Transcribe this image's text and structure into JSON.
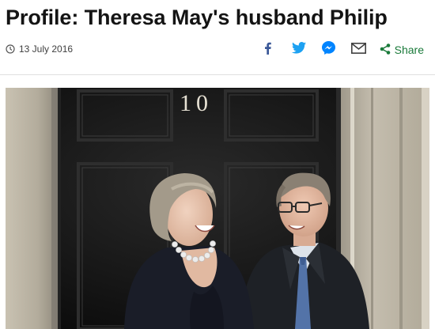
{
  "article": {
    "headline": "Profile: Theresa May's husband Philip",
    "date": "13 July 2016"
  },
  "share_bar": {
    "share_label": "Share",
    "icons": [
      "facebook-icon",
      "twitter-icon",
      "messenger-icon",
      "email-icon",
      "share-icon"
    ]
  },
  "photo": {
    "door_number": "10"
  },
  "colors": {
    "headline": "#141414",
    "facebook": "#3b5998",
    "twitter": "#1da1f2",
    "messenger": "#0084ff",
    "email": "#404040",
    "share": "#1a7a3a"
  }
}
